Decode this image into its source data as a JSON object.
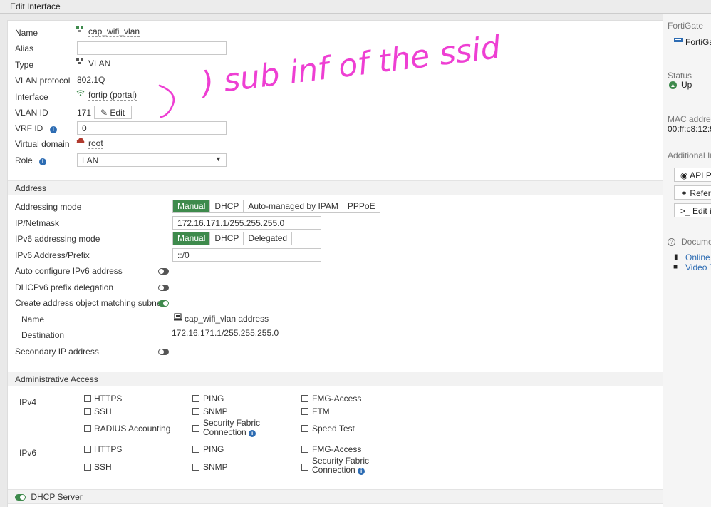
{
  "window": {
    "title": "Edit Interface"
  },
  "general": {
    "name_label": "Name",
    "name_value": "cap_wifi_vlan",
    "alias_label": "Alias",
    "alias_value": "",
    "type_label": "Type",
    "type_value": "VLAN",
    "vlan_protocol_label": "VLAN protocol",
    "vlan_protocol_value": "802.1Q",
    "interface_label": "Interface",
    "interface_value": "fortip (portal)",
    "vlan_id_label": "VLAN ID",
    "vlan_id_value": "171",
    "edit_label": "Edit",
    "vrf_label": "VRF ID",
    "vrf_value": "0",
    "vdom_label": "Virtual domain",
    "vdom_value": "root",
    "role_label": "Role",
    "role_value": "LAN"
  },
  "address": {
    "section_title": "Address",
    "addressing_mode_label": "Addressing mode",
    "addressing_modes": [
      "Manual",
      "DHCP",
      "Auto-managed by IPAM",
      "PPPoE"
    ],
    "ip_label": "IP/Netmask",
    "ip_value": "172.16.171.1/255.255.255.0",
    "ipv6_mode_label": "IPv6 addressing mode",
    "ipv6_modes": [
      "Manual",
      "DHCP",
      "Delegated"
    ],
    "ipv6_prefix_label": "IPv6 Address/Prefix",
    "ipv6_prefix_value": "::/0",
    "auto_ipv6_label": "Auto configure IPv6 address",
    "dhcpv6_label": "DHCPv6 prefix delegation",
    "create_obj_label": "Create address object matching subnet",
    "obj_name_label": "Name",
    "obj_name_value": "cap_wifi_vlan address",
    "obj_dest_label": "Destination",
    "obj_dest_value": "172.16.171.1/255.255.255.0",
    "secondary_label": "Secondary IP address"
  },
  "access": {
    "section_title": "Administrative Access",
    "ipv4_label": "IPv4",
    "ipv4": {
      "https": "HTTPS",
      "ping": "PING",
      "fmg": "FMG-Access",
      "ssh": "SSH",
      "snmp": "SNMP",
      "ftm": "FTM",
      "radius": "RADIUS Accounting",
      "fabric_1": "Security Fabric",
      "fabric_2": "Connection",
      "speed": "Speed Test"
    },
    "ipv6_label": "IPv6",
    "ipv6": {
      "https": "HTTPS",
      "ping": "PING",
      "fmg": "FMG-Access",
      "ssh": "SSH",
      "snmp": "SNMP",
      "fabric_1": "Security Fabric",
      "fabric_2": "Connection"
    }
  },
  "dhcp": {
    "label": "DHCP Server"
  },
  "annotation": {
    "text": ") sub inf of the ssid"
  },
  "sidebar": {
    "device_label": "FortiGate",
    "device_value": "FortiGa",
    "status_label": "Status",
    "status_value": "Up",
    "mac_label": "MAC addres",
    "mac_value": "00:ff:c8:12:9",
    "additional_label": "Additional In",
    "api_label": "API P",
    "ref_label": "Refer",
    "edit_label": "Edit i",
    "docs_label": "Docume",
    "online_label": "Online",
    "video_label": "Video T"
  },
  "colors": {
    "accent": "#3e8a4c",
    "info": "#2d6cb3",
    "annotation": "#ee3fd3"
  }
}
